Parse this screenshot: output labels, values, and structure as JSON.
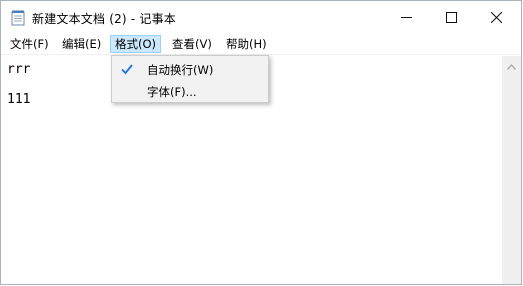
{
  "window": {
    "title": "新建文本文档 (2) - 记事本"
  },
  "caption_buttons": {
    "minimize_icon": "minimize-icon",
    "maximize_icon": "maximize-icon",
    "close_icon": "close-icon"
  },
  "menubar": {
    "file": "文件(F)",
    "edit": "编辑(E)",
    "format": "格式(O)",
    "view": "查看(V)",
    "help": "帮助(H)",
    "active": "format"
  },
  "format_menu": {
    "items": [
      {
        "label": "自动换行(W)",
        "checked": true
      },
      {
        "label": "字体(F)...",
        "checked": false
      }
    ]
  },
  "editor": {
    "lines": [
      "rrr",
      "111"
    ]
  },
  "colors": {
    "menu_highlight": "#cce8ff",
    "check": "#1a73d9"
  }
}
